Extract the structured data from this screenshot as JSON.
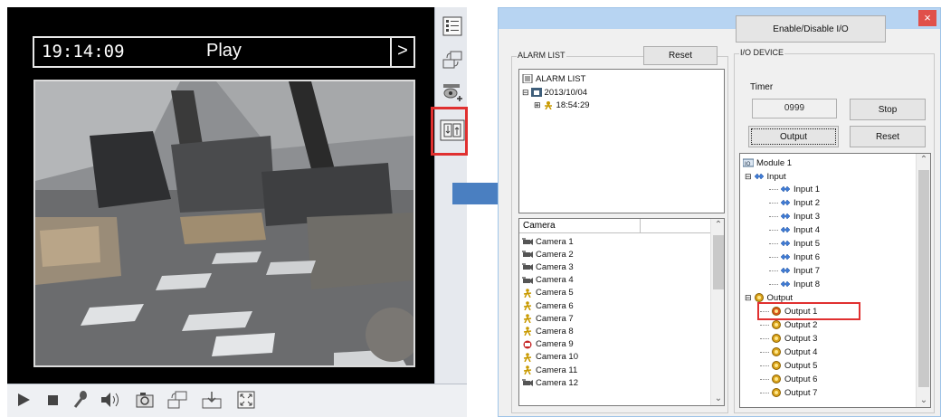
{
  "player": {
    "osd_time": "19:14:09",
    "osd_mode": "Play",
    "osd_next": ">",
    "side_buttons": [
      {
        "name": "list-view-icon"
      },
      {
        "name": "switch-view-icon"
      },
      {
        "name": "ptz-camera-icon"
      },
      {
        "name": "io-control-icon",
        "highlighted": true
      }
    ],
    "controls": [
      {
        "name": "play-icon"
      },
      {
        "name": "stop-icon"
      },
      {
        "name": "microphone-icon"
      },
      {
        "name": "speaker-icon"
      },
      {
        "name": "snapshot-camera-icon"
      },
      {
        "name": "switch-view-icon"
      },
      {
        "name": "download-icon"
      },
      {
        "name": "fullscreen-icon"
      }
    ]
  },
  "arrow_color": "#4a7fc1",
  "highlight_color": "#e03030",
  "dialog": {
    "close_label": "×",
    "alarm_list": {
      "group_label": "ALARM LIST",
      "reset_label": "Reset",
      "root": "ALARM LIST",
      "date": "2013/10/04",
      "time": "18:54:29"
    },
    "camera_list": {
      "header": "Camera",
      "items": [
        "Camera 1",
        "Camera 2",
        "Camera 3",
        "Camera 4",
        "Camera 5",
        "Camera 6",
        "Camera 7",
        "Camera 8",
        "Camera 9",
        "Camera 10",
        "Camera 11",
        "Camera 12"
      ],
      "icon_types": [
        "cam",
        "cam",
        "cam",
        "cam",
        "motion",
        "motion",
        "motion",
        "motion",
        "alarm",
        "motion",
        "motion",
        "cam"
      ]
    },
    "io": {
      "enable_label": "Enable/Disable I/O",
      "group_label": "I/O DEVICE",
      "timer_label": "Timer",
      "timer_value": "0999",
      "stop_label": "Stop",
      "output_label": "Output",
      "reset_label": "Reset",
      "tree": {
        "module": "Module 1",
        "input_group": "Input",
        "inputs": [
          "Input 1",
          "Input 2",
          "Input 3",
          "Input 4",
          "Input 5",
          "Input 6",
          "Input 7",
          "Input 8"
        ],
        "output_group": "Output",
        "outputs": [
          "Output 1",
          "Output 2",
          "Output 3",
          "Output 4",
          "Output 5",
          "Output 6",
          "Output 7"
        ],
        "highlighted_output": "Output 1"
      }
    }
  }
}
